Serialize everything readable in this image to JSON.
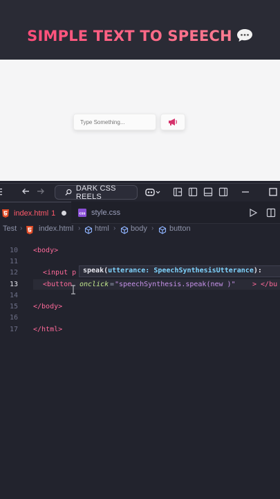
{
  "banner": {
    "title": "SIMPLE TEXT TO SPEECH"
  },
  "preview": {
    "input_placeholder": "Type Something..."
  },
  "titlebar": {
    "command_center_label": "DARK CSS REELS"
  },
  "tabs": [
    {
      "label": "index.html",
      "badge": "1",
      "active": true
    },
    {
      "label": "style.css",
      "active": false
    }
  ],
  "breadcrumbs": [
    "Test",
    "index.html",
    "html",
    "body",
    "button"
  ],
  "editor": {
    "line_numbers": [
      "10",
      "11",
      "12",
      "13",
      "14",
      "15",
      "16",
      "17"
    ],
    "lines": {
      "l10": "<body>",
      "l12_part": "<input p",
      "l13_tag": "<button",
      "l13_attr": "onclick",
      "l13_value": "\"speechSynthesis.speak(new )\"",
      "l13_tail": "> </bu",
      "l15": "</body>",
      "l17": "</html>"
    },
    "hint": {
      "fn": "speak(",
      "param": "utterance: SpeechSynthesisUtterance",
      "close": "):"
    }
  },
  "colors": {
    "accent_pink": "#ff5a7a",
    "background": "#22232d",
    "tag": "#ff6a9a",
    "attribute": "#c3e88d",
    "string": "#c792ea"
  }
}
